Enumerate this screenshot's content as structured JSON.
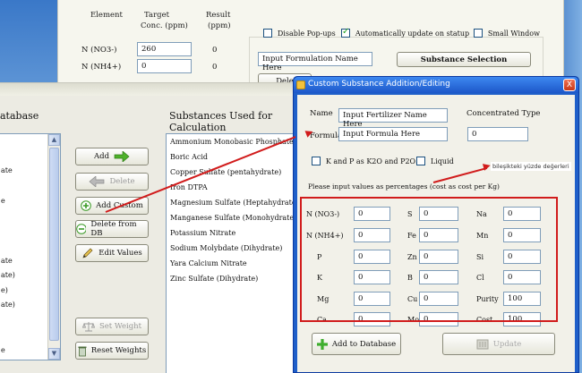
{
  "top_window": {
    "col_element": "Element",
    "col_target": "Target",
    "col_target2": "Conc. (ppm)",
    "col_result": "Result",
    "col_result2": "(ppm)",
    "rows": [
      {
        "label": "N (NO3-)",
        "value": "260",
        "result": "0"
      },
      {
        "label": "N (NH4+)",
        "value": "0",
        "result": "0"
      }
    ],
    "disable_popups": "Disable Pop-ups",
    "auto_update": "Automatically update on statup",
    "small_window": "Small Window",
    "formulation_name": "Input Formulation Name Here",
    "substance_selection": "Substance Selection",
    "partial_button": "Dele"
  },
  "left_window": {
    "database_title": "atabase",
    "substances_title": "Substances Used for Calculation",
    "db_items": [
      "ate",
      "e",
      "ate",
      "ate)",
      "e)",
      "ate)",
      "e"
    ],
    "substances": [
      "Ammonium Monobasic Phosphate",
      "Boric Acid",
      "Copper Sulfate (pentahydrate)",
      "Iron DTPA",
      "Magnesium Sulfate (Heptahydrate)",
      "Manganese Sulfate (Monohydrate)",
      "Potassium Nitrate",
      "Sodium Molybdate (Dihydrate)",
      "Yara Calcium Nitrate",
      "Zinc Sulfate (Dihydrate)"
    ],
    "add": "Add",
    "delete": "Delete",
    "add_custom": "Add Custom",
    "delete_from_db": "Delete from DB",
    "edit_values": "Edit Values",
    "set_weight": "Set Weight",
    "reset_weights": "Reset Weights"
  },
  "dialog": {
    "title": "Custom Substance Addition/Editing",
    "close": "X",
    "name_label": "Name",
    "name_value": "Input Fertilizer Name Here",
    "formula_label": "Formula",
    "formula_value": "Input Formula Here",
    "conc_type_label": "Concentrated Type",
    "conc_type_value": "0",
    "k_and_p": "K and P as K2O and P2O5",
    "liquid": "Liquid",
    "instructions": "Please input values as percentages (cost as cost per Kg)",
    "note": "bileşikteki yüzde değerleri",
    "elements": [
      {
        "label": "N (NO3-)",
        "value": "0"
      },
      {
        "label": "S",
        "value": "0"
      },
      {
        "label": "Na",
        "value": "0"
      },
      {
        "label": "N (NH4+)",
        "value": "0"
      },
      {
        "label": "Fe",
        "value": "0"
      },
      {
        "label": "Mn",
        "value": "0"
      },
      {
        "label": "P",
        "value": "0"
      },
      {
        "label": "Zn",
        "value": "0"
      },
      {
        "label": "Si",
        "value": "0"
      },
      {
        "label": "K",
        "value": "0"
      },
      {
        "label": "B",
        "value": "0"
      },
      {
        "label": "Cl",
        "value": "0"
      },
      {
        "label": "Mg",
        "value": "0"
      },
      {
        "label": "Cu",
        "value": "0"
      },
      {
        "label": "Purity",
        "value": "100"
      },
      {
        "label": "Ca",
        "value": "0"
      },
      {
        "label": "Mo",
        "value": "0"
      },
      {
        "label": "Cost",
        "value": "100"
      }
    ],
    "add_to_db": "Add to Database",
    "update": "Update"
  }
}
